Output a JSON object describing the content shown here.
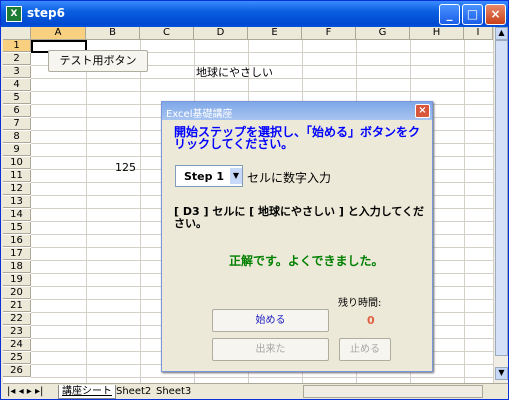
{
  "window": {
    "title": "step6",
    "icon": "excel-icon"
  },
  "sheet": {
    "columns": [
      "A",
      "B",
      "C",
      "D",
      "E",
      "F",
      "G",
      "H",
      "I"
    ],
    "rows": [
      "1",
      "2",
      "3",
      "4",
      "5",
      "6",
      "7",
      "8",
      "9",
      "10",
      "11",
      "12",
      "13",
      "14",
      "15",
      "16",
      "17",
      "18",
      "19",
      "20",
      "21",
      "22",
      "23",
      "24",
      "25",
      "26"
    ],
    "cells": {
      "D3": "地球にやさしい",
      "B10": "125"
    },
    "test_button_label": "テスト用ボタン"
  },
  "tabs": [
    "講座シート",
    "Sheet2",
    "Sheet3"
  ],
  "dialog": {
    "title": "Excel基礎講座",
    "instruction": "開始ステップを選択し、「始める」ボタンをクリックしてください。",
    "step_value": "Step 1",
    "step_desc": "セルに数字入力",
    "task": "[ D3 ] セルに [ 地球にやさしい ] と入力してください。",
    "result": "正解です。よくできました。",
    "timer_label": "残り時間:",
    "timer_value": "0",
    "start_label": "始める",
    "done_label": "出来た",
    "stop_label": "止める",
    "colors": {
      "instruction": "#0000FF",
      "result": "#008000",
      "timer": "#E06040"
    }
  }
}
